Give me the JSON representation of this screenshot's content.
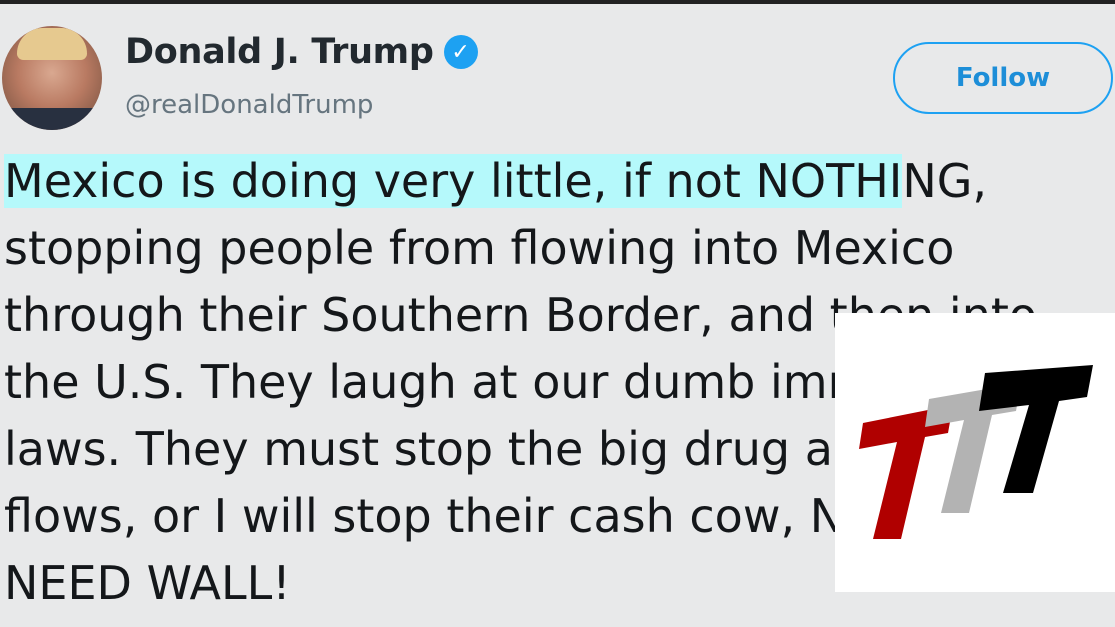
{
  "tweet_card": {
    "author": {
      "name": "Donald J. Trump",
      "handle": "@realDonaldTrump",
      "verified_icon": "verified-badge-icon",
      "verified_color": "#1da1f2"
    },
    "follow_button_label": "Follow",
    "text_lines": [
      "Mexico is doing very little, if not NOTHING,",
      "stopping people from flowing into Mexico",
      "through their Southern Border, and then into",
      "the U.S. They laugh at our dumb immigration",
      "laws. They must stop the big drug and people",
      "flows, or I will stop their cash cow, NAFTA.",
      "NEED WALL!"
    ],
    "highlighted_text": "Mexico is doing very little, if not NOTHI",
    "highlight_color": "#b5f9fb"
  },
  "overlay_logo": {
    "icon": "ttt-logo-icon",
    "colors": [
      "#b00000",
      "#b3b3b3",
      "#000000"
    ]
  }
}
